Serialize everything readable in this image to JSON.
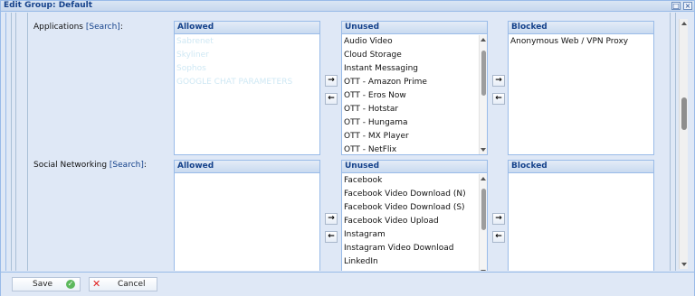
{
  "window": {
    "title": "Edit Group: Default",
    "restore_icon": "□",
    "close_icon": "×"
  },
  "groups": [
    {
      "label": "Applications",
      "search_link": "[Search]",
      "colon": ":",
      "allowed": {
        "header": "Allowed",
        "items": [
          "Sabrenet",
          "Skyliner",
          "Sophos",
          "GOOGLE CHAT PARAMETERS"
        ]
      },
      "unused": {
        "header": "Unused",
        "items": [
          "Audio Video",
          "Cloud Storage",
          "Instant Messaging",
          "OTT - Amazon Prime",
          "OTT - Eros Now",
          "OTT - Hotstar",
          "OTT - Hungama",
          "OTT - MX Player",
          "OTT - NetFlix"
        ]
      },
      "blocked": {
        "header": "Blocked",
        "items": [
          "Anonymous Web / VPN Proxy"
        ]
      }
    },
    {
      "label": "Social Networking",
      "search_link": "[Search]",
      "colon": ":",
      "allowed": {
        "header": "Allowed",
        "items": []
      },
      "unused": {
        "header": "Unused",
        "items": [
          "Facebook",
          "Facebook Video Download (N)",
          "Facebook Video Download (S)",
          "Facebook Video Upload",
          "Instagram",
          "Instagram Video Download",
          "LinkedIn"
        ]
      },
      "blocked": {
        "header": "Blocked",
        "items": []
      }
    }
  ],
  "move_buttons": {
    "right": "→",
    "left": "←"
  },
  "footer": {
    "save_label": "Save",
    "cancel_label": "Cancel",
    "save_icon": "✓",
    "cancel_icon": "✕"
  },
  "colors": {
    "header_text": "#15428b",
    "border": "#99bbe8",
    "background": "#dfe8f6"
  }
}
